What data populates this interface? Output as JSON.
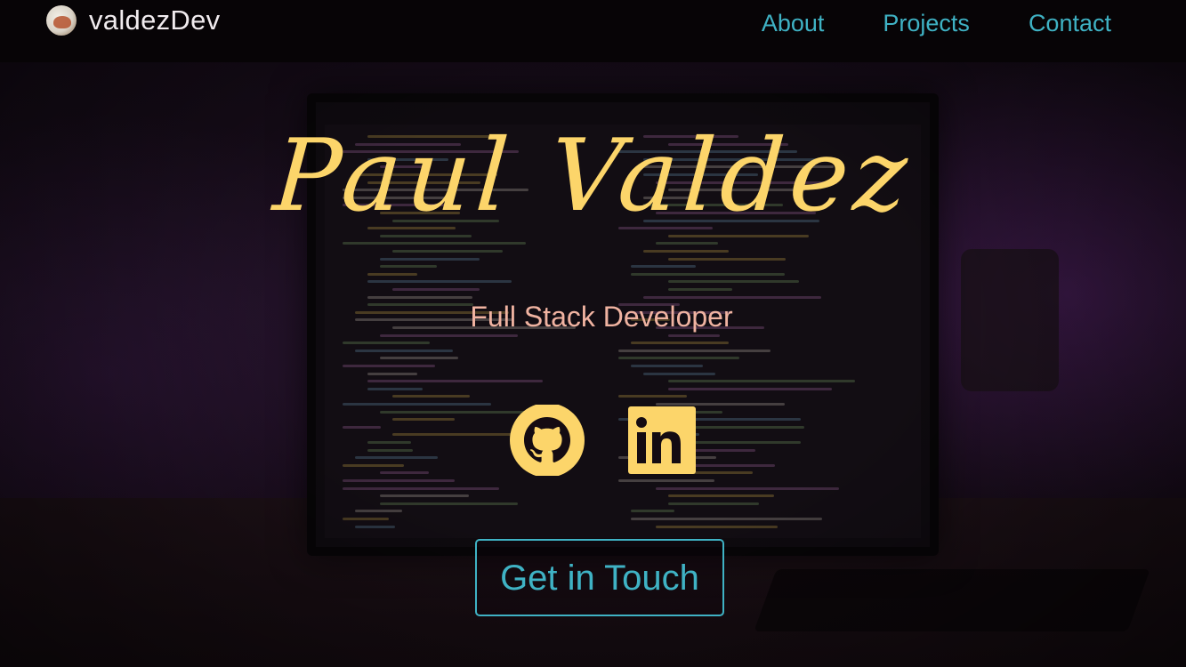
{
  "header": {
    "brand": "valdezDev",
    "nav": [
      {
        "label": "About"
      },
      {
        "label": "Projects"
      },
      {
        "label": "Contact"
      }
    ]
  },
  "hero": {
    "name": "Paul Valdez",
    "role": "Full Stack Developer",
    "cta_label": "Get in Touch"
  },
  "socials": [
    {
      "icon": "github-icon"
    },
    {
      "icon": "linkedin-icon"
    }
  ],
  "colors": {
    "accent": "#3fb2c4",
    "name": "#fcd56a",
    "role": "#f0b3a1",
    "icon": "#fcd56a"
  }
}
